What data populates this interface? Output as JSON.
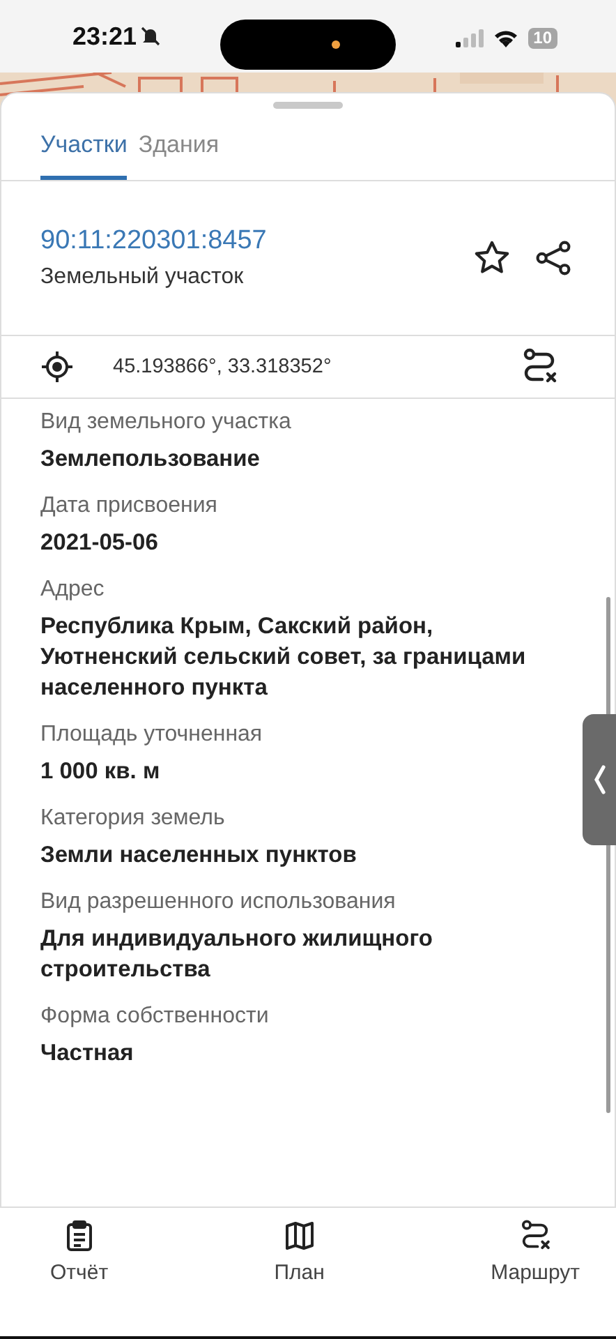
{
  "status_bar": {
    "time": "23:21",
    "battery": "10"
  },
  "tabs": [
    {
      "label": "Участки",
      "selected": true
    },
    {
      "label": "Здания",
      "selected": false
    }
  ],
  "parcel": {
    "number": "90:11:220301:8457",
    "type": "Земельный участок"
  },
  "coordinates": "45.193866°, 33.318352°",
  "fields": [
    {
      "label": "Вид земельного участка",
      "value": "Землепользование"
    },
    {
      "label": "Дата присвоения",
      "value": "2021-05-06"
    },
    {
      "label": "Адрес",
      "value": "Республика Крым, Сакский район, Уютненский сельский совет, за границами населенного пункта"
    },
    {
      "label": "Площадь уточненная",
      "value": "1 000 кв. м"
    },
    {
      "label": "Категория земель",
      "value": "Земли населенных пунктов"
    },
    {
      "label": "Вид разрешенного использования",
      "value": "Для индивидуального жилищного строительства"
    },
    {
      "label": "Форма собственности",
      "value": "Частная"
    }
  ],
  "bottom_nav": [
    {
      "kind": "report",
      "label": "Отчёт"
    },
    {
      "kind": "plan",
      "label": "План"
    },
    {
      "kind": "route",
      "label": "Маршрут"
    }
  ]
}
